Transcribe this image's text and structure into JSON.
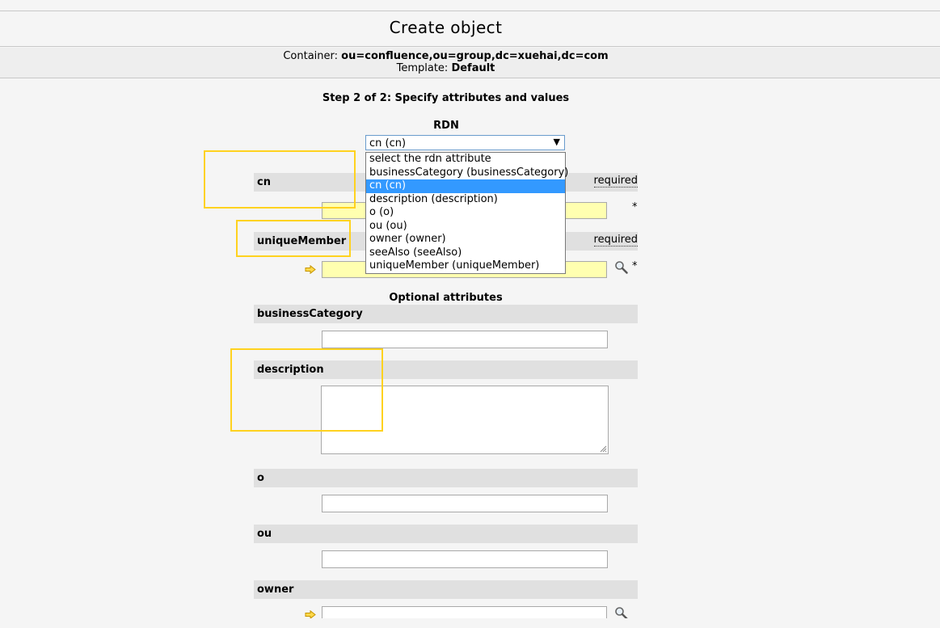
{
  "page": {
    "title": "Create object"
  },
  "info": {
    "container_label": "Container:",
    "container_value": "ou=confluence,ou=group,dc=xuehai,dc=com",
    "template_label": "Template:",
    "template_value": "Default"
  },
  "step": "Step 2 of 2: Specify attributes and values",
  "rdn": {
    "label": "RDN",
    "selected": "cn (cn)",
    "options": [
      "select the rdn attribute",
      "businessCategory (businessCategory)",
      "cn (cn)",
      "description (description)",
      "o (o)",
      "ou (ou)",
      "owner (owner)",
      "seeAlso (seeAlso)",
      "uniqueMember (uniqueMember)"
    ]
  },
  "required": {
    "required_label": "required",
    "star": "*",
    "cn": {
      "label": "cn"
    },
    "uniqueMember": {
      "label": "uniqueMember"
    }
  },
  "optional": {
    "title": "Optional attributes",
    "businessCategory": "businessCategory",
    "description": "description",
    "o": "o",
    "ou": "ou",
    "owner": "owner"
  },
  "colors": {
    "highlight": "#ffd21f",
    "required_field": "#ffffb0",
    "selected_option": "#3399ff",
    "header_bg": "#e0e0e0"
  },
  "icons": [
    "arrow-right-icon",
    "search-icon",
    "dropdown-arrow-icon"
  ]
}
